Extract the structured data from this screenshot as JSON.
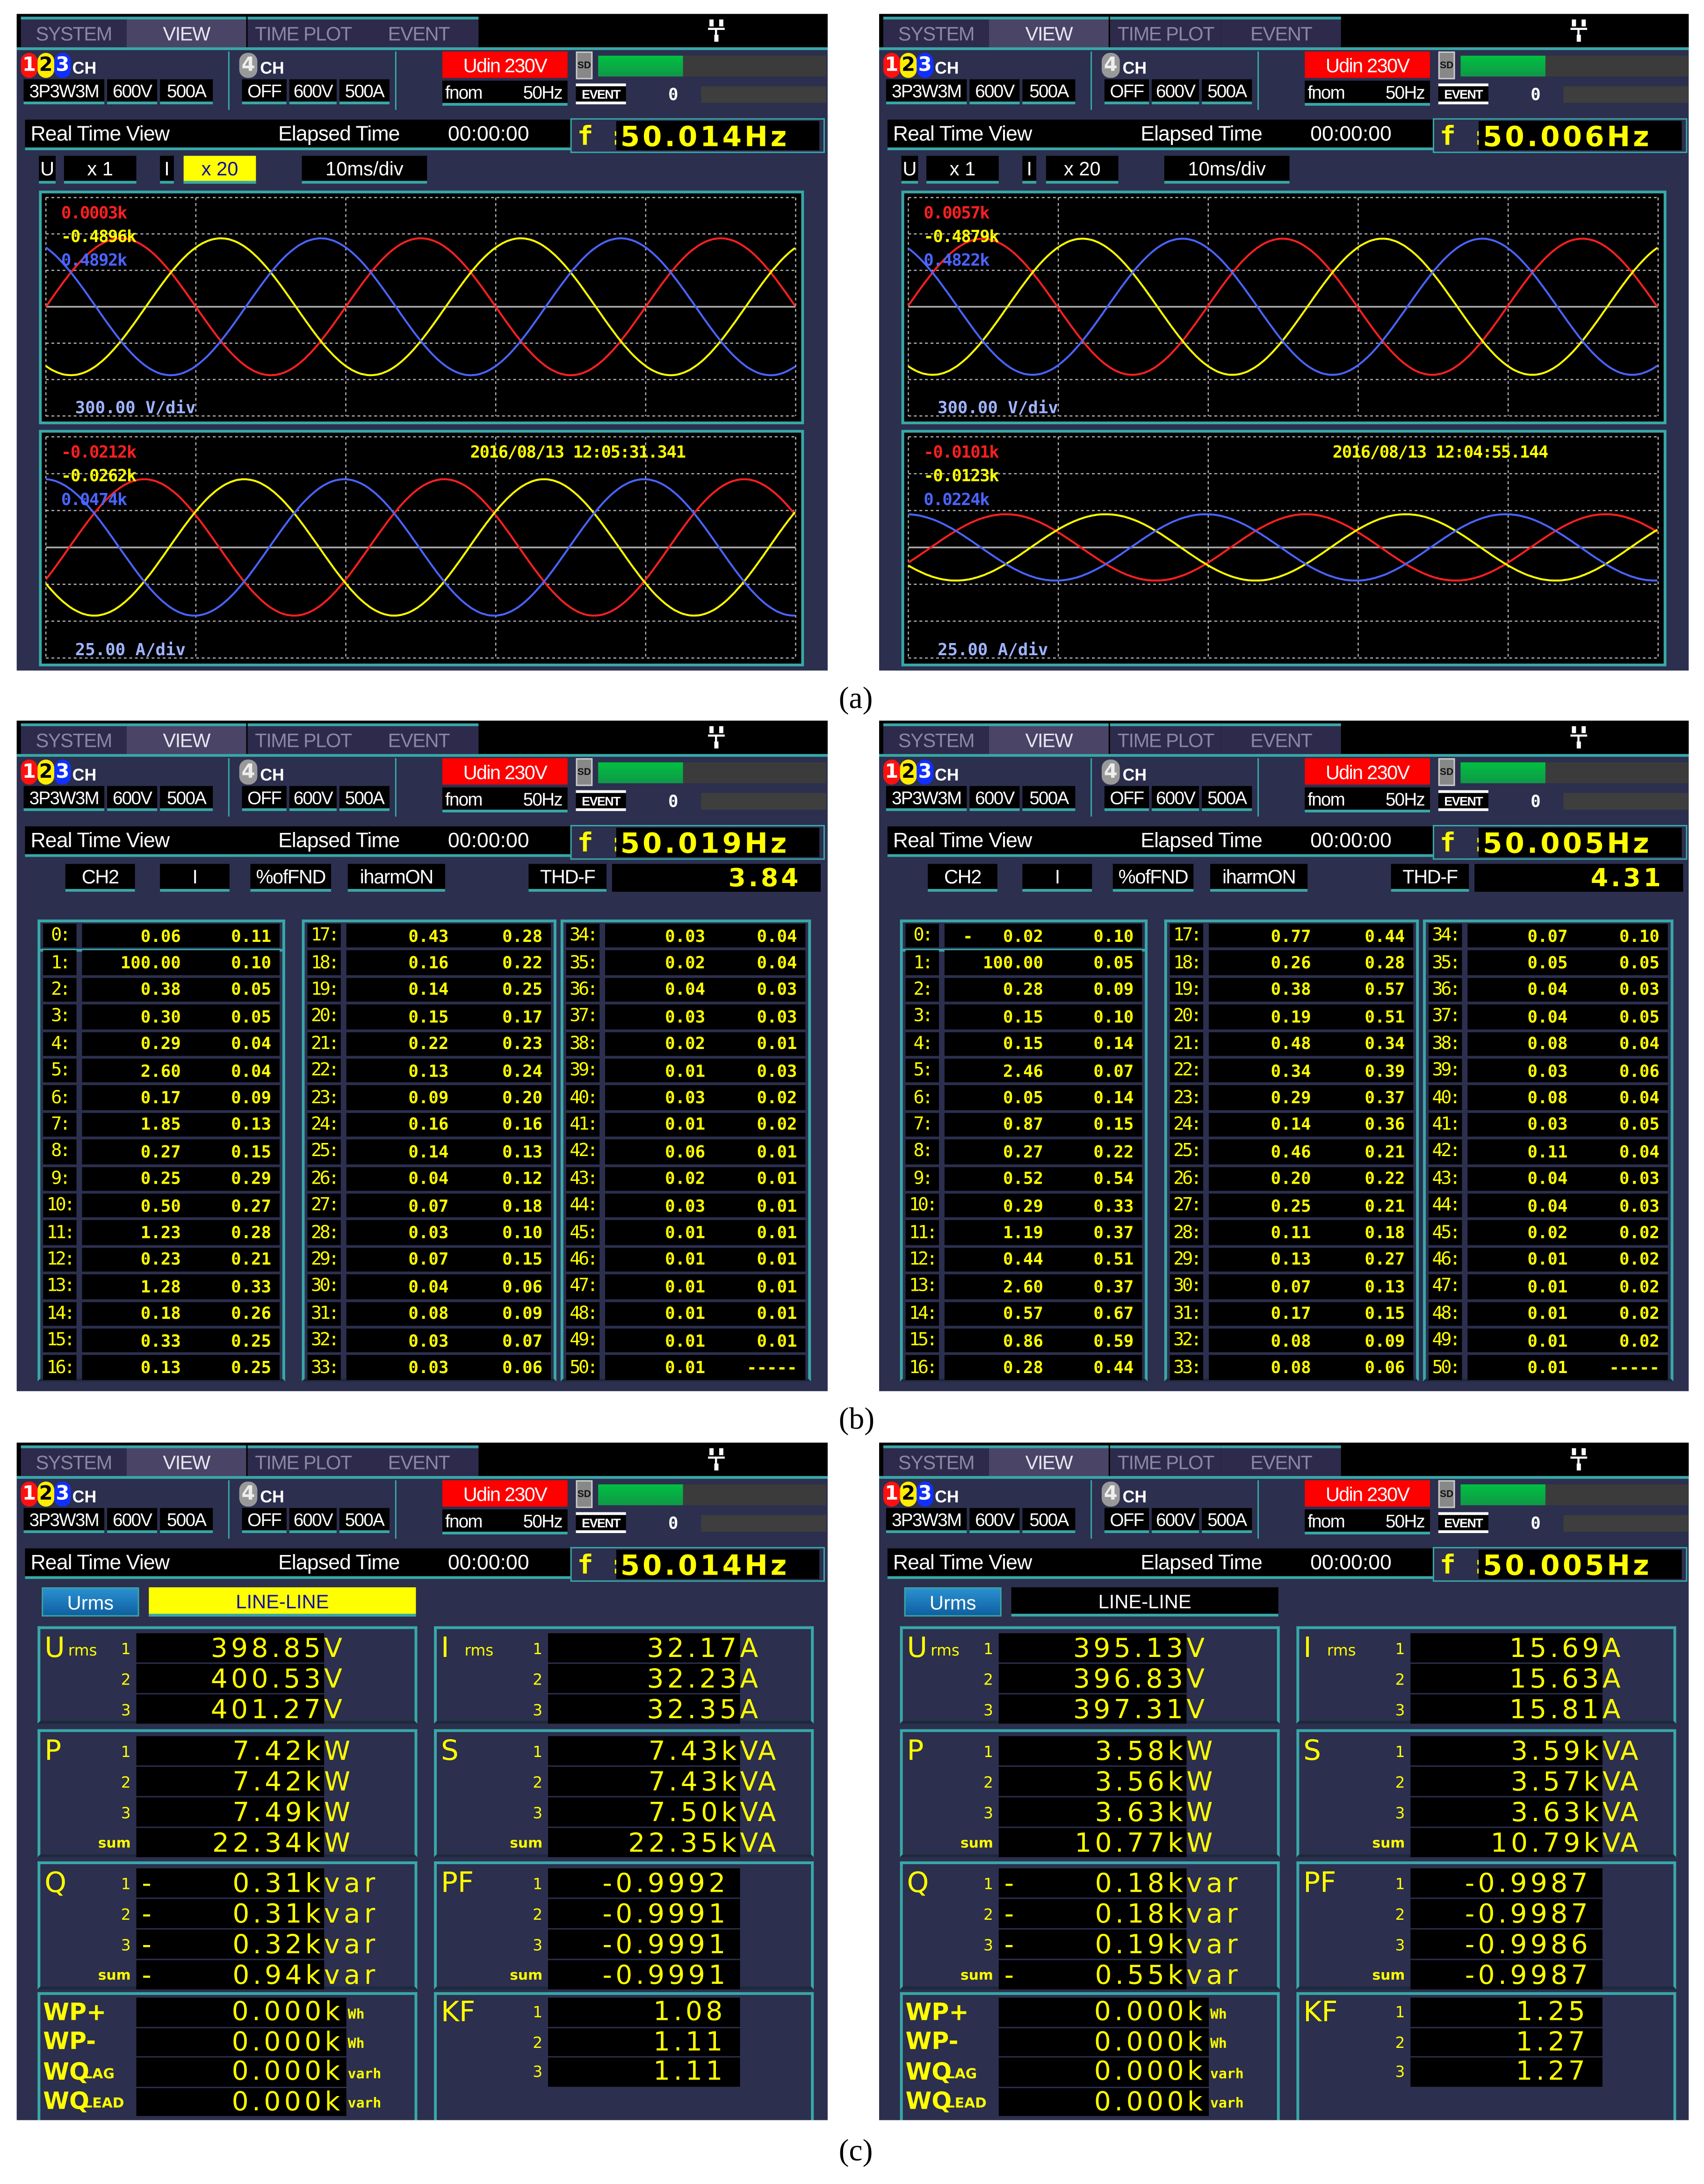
{
  "header": {
    "tabs": [
      "SYSTEM",
      "VIEW",
      "TIME PLOT",
      "EVENT"
    ],
    "active_tab": "VIEW",
    "ch123": {
      "num": [
        "1",
        "2",
        "3"
      ],
      "suffix": "CH",
      "wiring": "3P3W3M",
      "range_v": "600V",
      "range_a": "500A"
    },
    "ch4": {
      "num": "4",
      "suffix": "CH",
      "state": "OFF",
      "range_v": "600V",
      "range_a": "500A"
    },
    "udin": "Udin 230V",
    "fnom_label": "fnom",
    "fnom": "50Hz",
    "sd": "SD",
    "sd_usage_percent": 37,
    "event_label": "EVENT",
    "event_count": "0",
    "mode": "Real Time View",
    "elapsed_label": "Elapsed Time",
    "elapsed": "00:00:00",
    "freq_label": "f :"
  },
  "figure_labels": {
    "a": "(a)",
    "b": "(b)",
    "c": "(c)"
  },
  "colors": {
    "phase1": "#ff2020",
    "phase2": "#ffff00",
    "phase3": "#4a64ff",
    "accent": "#38a8a8",
    "screen_bg": "#2c2f4e"
  },
  "screens": [
    {
      "panel": "a",
      "freq": "50.014Hz",
      "controls": {
        "u_label": "U",
        "u_scale": "x 1",
        "i_label": "I",
        "i_scale": "x 20",
        "i_scale_highlighted": true,
        "timebase": "10ms/div"
      },
      "cycles": 2.5,
      "voltage": {
        "readouts": [
          "0.0003k",
          "-0.4896k",
          "0.4892k"
        ],
        "scale": "300.00 V/div",
        "amplitude_div": 1.88,
        "phase_deg": [
          0,
          -120,
          120
        ]
      },
      "current": {
        "readouts": [
          "-0.0212k",
          "-0.0262k",
          "0.0474k"
        ],
        "timestamp": "2016/08/13 12:05:31.341",
        "scale": "25.00 A/div",
        "amplitude_div": 1.85,
        "phase_deg": [
          -28,
          -148,
          92
        ]
      }
    },
    {
      "panel": "a",
      "freq": "50.006Hz",
      "controls": {
        "u_label": "U",
        "u_scale": "x 1",
        "i_label": "I",
        "i_scale": "x 20",
        "i_scale_highlighted": false,
        "timebase": "10ms/div"
      },
      "cycles": 2.5,
      "voltage": {
        "readouts": [
          "0.0057k",
          "-0.4879k",
          "0.4822k"
        ],
        "scale": "300.00 V/div",
        "amplitude_div": 1.87,
        "phase_deg": [
          1,
          -119,
          121
        ]
      },
      "current": {
        "readouts": [
          "-0.0101k",
          "-0.0123k",
          "0.0224k"
        ],
        "timestamp": "2016/08/13 12:04:55.144",
        "scale": "25.00 A/div",
        "amplitude_div": 0.9,
        "phase_deg": [
          -27,
          -147,
          93
        ]
      }
    },
    {
      "panel": "b",
      "freq": "50.019Hz",
      "controls": {
        "channel": "CH2",
        "quantity": "I",
        "unit": "%ofFND",
        "mode": "iharmON",
        "thd_label": "THD-F",
        "thd_value": "3.84"
      },
      "harmonics": [
        [
          [
            "0:",
            "0.06",
            "0.11"
          ],
          [
            "1:",
            "100.00",
            "0.10"
          ],
          [
            "2:",
            "0.38",
            "0.05"
          ],
          [
            "3:",
            "0.30",
            "0.05"
          ],
          [
            "4:",
            "0.29",
            "0.04"
          ],
          [
            "5:",
            "2.60",
            "0.04"
          ],
          [
            "6:",
            "0.17",
            "0.09"
          ],
          [
            "7:",
            "1.85",
            "0.13"
          ],
          [
            "8:",
            "0.27",
            "0.15"
          ],
          [
            "9:",
            "0.25",
            "0.29"
          ],
          [
            "10:",
            "0.50",
            "0.27"
          ],
          [
            "11:",
            "1.23",
            "0.28"
          ],
          [
            "12:",
            "0.23",
            "0.21"
          ],
          [
            "13:",
            "1.28",
            "0.33"
          ],
          [
            "14:",
            "0.18",
            "0.26"
          ],
          [
            "15:",
            "0.33",
            "0.25"
          ],
          [
            "16:",
            "0.13",
            "0.25"
          ]
        ],
        [
          [
            "17:",
            "0.43",
            "0.28"
          ],
          [
            "18:",
            "0.16",
            "0.22"
          ],
          [
            "19:",
            "0.14",
            "0.25"
          ],
          [
            "20:",
            "0.15",
            "0.17"
          ],
          [
            "21:",
            "0.22",
            "0.23"
          ],
          [
            "22:",
            "0.13",
            "0.24"
          ],
          [
            "23:",
            "0.09",
            "0.20"
          ],
          [
            "24:",
            "0.16",
            "0.16"
          ],
          [
            "25:",
            "0.14",
            "0.13"
          ],
          [
            "26:",
            "0.04",
            "0.12"
          ],
          [
            "27:",
            "0.07",
            "0.18"
          ],
          [
            "28:",
            "0.03",
            "0.10"
          ],
          [
            "29:",
            "0.07",
            "0.15"
          ],
          [
            "30:",
            "0.04",
            "0.06"
          ],
          [
            "31:",
            "0.08",
            "0.09"
          ],
          [
            "32:",
            "0.03",
            "0.07"
          ],
          [
            "33:",
            "0.03",
            "0.06"
          ]
        ],
        [
          [
            "34:",
            "0.03",
            "0.04"
          ],
          [
            "35:",
            "0.02",
            "0.04"
          ],
          [
            "36:",
            "0.04",
            "0.03"
          ],
          [
            "37:",
            "0.03",
            "0.03"
          ],
          [
            "38:",
            "0.02",
            "0.01"
          ],
          [
            "39:",
            "0.01",
            "0.03"
          ],
          [
            "40:",
            "0.03",
            "0.02"
          ],
          [
            "41:",
            "0.01",
            "0.02"
          ],
          [
            "42:",
            "0.06",
            "0.01"
          ],
          [
            "43:",
            "0.02",
            "0.01"
          ],
          [
            "44:",
            "0.03",
            "0.01"
          ],
          [
            "45:",
            "0.01",
            "0.01"
          ],
          [
            "46:",
            "0.01",
            "0.01"
          ],
          [
            "47:",
            "0.01",
            "0.01"
          ],
          [
            "48:",
            "0.01",
            "0.01"
          ],
          [
            "49:",
            "0.01",
            "0.01"
          ],
          [
            "50:",
            "0.01",
            "-----"
          ]
        ]
      ]
    },
    {
      "panel": "b",
      "freq": "50.005Hz",
      "controls": {
        "channel": "CH2",
        "quantity": "I",
        "unit": "%ofFND",
        "mode": "iharmON",
        "thd_label": "THD-F",
        "thd_value": "4.31"
      },
      "harmonics": [
        [
          [
            "0:",
            "-   0.02",
            "0.10"
          ],
          [
            "1:",
            "100.00",
            "0.05"
          ],
          [
            "2:",
            "0.28",
            "0.09"
          ],
          [
            "3:",
            "0.15",
            "0.10"
          ],
          [
            "4:",
            "0.15",
            "0.14"
          ],
          [
            "5:",
            "2.46",
            "0.07"
          ],
          [
            "6:",
            "0.05",
            "0.14"
          ],
          [
            "7:",
            "0.87",
            "0.15"
          ],
          [
            "8:",
            "0.27",
            "0.22"
          ],
          [
            "9:",
            "0.52",
            "0.54"
          ],
          [
            "10:",
            "0.29",
            "0.33"
          ],
          [
            "11:",
            "1.19",
            "0.37"
          ],
          [
            "12:",
            "0.44",
            "0.51"
          ],
          [
            "13:",
            "2.60",
            "0.37"
          ],
          [
            "14:",
            "0.57",
            "0.67"
          ],
          [
            "15:",
            "0.86",
            "0.59"
          ],
          [
            "16:",
            "0.28",
            "0.44"
          ]
        ],
        [
          [
            "17:",
            "0.77",
            "0.44"
          ],
          [
            "18:",
            "0.26",
            "0.28"
          ],
          [
            "19:",
            "0.38",
            "0.57"
          ],
          [
            "20:",
            "0.19",
            "0.51"
          ],
          [
            "21:",
            "0.48",
            "0.34"
          ],
          [
            "22:",
            "0.34",
            "0.39"
          ],
          [
            "23:",
            "0.29",
            "0.37"
          ],
          [
            "24:",
            "0.14",
            "0.36"
          ],
          [
            "25:",
            "0.46",
            "0.21"
          ],
          [
            "26:",
            "0.20",
            "0.22"
          ],
          [
            "27:",
            "0.25",
            "0.21"
          ],
          [
            "28:",
            "0.11",
            "0.18"
          ],
          [
            "29:",
            "0.13",
            "0.27"
          ],
          [
            "30:",
            "0.07",
            "0.13"
          ],
          [
            "31:",
            "0.17",
            "0.15"
          ],
          [
            "32:",
            "0.08",
            "0.09"
          ],
          [
            "33:",
            "0.08",
            "0.06"
          ]
        ],
        [
          [
            "34:",
            "0.07",
            "0.10"
          ],
          [
            "35:",
            "0.05",
            "0.05"
          ],
          [
            "36:",
            "0.04",
            "0.03"
          ],
          [
            "37:",
            "0.04",
            "0.05"
          ],
          [
            "38:",
            "0.08",
            "0.04"
          ],
          [
            "39:",
            "0.03",
            "0.06"
          ],
          [
            "40:",
            "0.08",
            "0.04"
          ],
          [
            "41:",
            "0.03",
            "0.05"
          ],
          [
            "42:",
            "0.11",
            "0.04"
          ],
          [
            "43:",
            "0.04",
            "0.03"
          ],
          [
            "44:",
            "0.04",
            "0.03"
          ],
          [
            "45:",
            "0.02",
            "0.02"
          ],
          [
            "46:",
            "0.01",
            "0.02"
          ],
          [
            "47:",
            "0.01",
            "0.02"
          ],
          [
            "48:",
            "0.01",
            "0.02"
          ],
          [
            "49:",
            "0.01",
            "0.02"
          ],
          [
            "50:",
            "0.01",
            "-----"
          ]
        ]
      ]
    },
    {
      "panel": "c",
      "freq": "50.014Hz",
      "controls": {
        "button": "Urms",
        "connection": "LINE-LINE",
        "connection_highlighted": true
      },
      "urms": {
        "label": "U",
        "sub": "rms",
        "phases": [
          "1",
          "2",
          "3"
        ],
        "values": [
          "398.85",
          "400.53",
          "401.27"
        ],
        "unit": "V"
      },
      "irms": {
        "label": "I",
        "sub": "rms",
        "phases": [
          "1",
          "2",
          "3"
        ],
        "values": [
          "32.17",
          "32.23",
          "32.35"
        ],
        "unit": "A"
      },
      "p": {
        "label": "P",
        "phases": [
          "1",
          "2",
          "3",
          "sum"
        ],
        "values": [
          "7.42k",
          "7.42k",
          "7.49k",
          "22.34k"
        ],
        "unit": "W"
      },
      "s": {
        "label": "S",
        "phases": [
          "1",
          "2",
          "3",
          "sum"
        ],
        "values": [
          "7.43k",
          "7.43k",
          "7.50k",
          "22.35k"
        ],
        "unit": "VA"
      },
      "q": {
        "label": "Q",
        "phases": [
          "1",
          "2",
          "3",
          "sum"
        ],
        "sign": "-",
        "values": [
          "0.31k",
          "0.31k",
          "0.32k",
          "0.94k"
        ],
        "unit": "var"
      },
      "pf": {
        "label": "PF",
        "phases": [
          "1",
          "2",
          "3",
          "sum"
        ],
        "values": [
          "-0.9992",
          "-0.9991",
          "-0.9991",
          "-0.9991"
        ]
      },
      "energy": [
        {
          "label": "WP+",
          "sub": "",
          "value": "0.000k",
          "unit": "Wh"
        },
        {
          "label": "WP-",
          "sub": "",
          "value": "0.000k",
          "unit": "Wh"
        },
        {
          "label": "WQ",
          "sub": "LAG",
          "value": "0.000k",
          "unit": "varh"
        },
        {
          "label": "WQ",
          "sub": "LEAD",
          "value": "0.000k",
          "unit": "varh"
        }
      ],
      "kf": {
        "label": "KF",
        "phases": [
          "1",
          "2",
          "3"
        ],
        "values": [
          "1.08",
          "1.11",
          "1.11"
        ]
      }
    },
    {
      "panel": "c",
      "freq": "50.005Hz",
      "controls": {
        "button": "Urms",
        "connection": "LINE-LINE",
        "connection_highlighted": false
      },
      "urms": {
        "label": "U",
        "sub": "rms",
        "phases": [
          "1",
          "2",
          "3"
        ],
        "values": [
          "395.13",
          "396.83",
          "397.31"
        ],
        "unit": "V"
      },
      "irms": {
        "label": "I",
        "sub": "rms",
        "phases": [
          "1",
          "2",
          "3"
        ],
        "values": [
          "15.69",
          "15.63",
          "15.81"
        ],
        "unit": "A"
      },
      "p": {
        "label": "P",
        "phases": [
          "1",
          "2",
          "3",
          "sum"
        ],
        "values": [
          "3.58k",
          "3.56k",
          "3.63k",
          "10.77k"
        ],
        "unit": "W"
      },
      "s": {
        "label": "S",
        "phases": [
          "1",
          "2",
          "3",
          "sum"
        ],
        "values": [
          "3.59k",
          "3.57k",
          "3.63k",
          "10.79k"
        ],
        "unit": "VA"
      },
      "q": {
        "label": "Q",
        "phases": [
          "1",
          "2",
          "3",
          "sum"
        ],
        "sign": "-",
        "values": [
          "0.18k",
          "0.18k",
          "0.19k",
          "0.55k"
        ],
        "unit": "var"
      },
      "pf": {
        "label": "PF",
        "phases": [
          "1",
          "2",
          "3",
          "sum"
        ],
        "values": [
          "-0.9987",
          "-0.9987",
          "-0.9986",
          "-0.9987"
        ]
      },
      "energy": [
        {
          "label": "WP+",
          "sub": "",
          "value": "0.000k",
          "unit": "Wh"
        },
        {
          "label": "WP-",
          "sub": "",
          "value": "0.000k",
          "unit": "Wh"
        },
        {
          "label": "WQ",
          "sub": "LAG",
          "value": "0.000k",
          "unit": "varh"
        },
        {
          "label": "WQ",
          "sub": "LEAD",
          "value": "0.000k",
          "unit": "varh"
        }
      ],
      "kf": {
        "label": "KF",
        "phases": [
          "1",
          "2",
          "3"
        ],
        "values": [
          "1.25",
          "1.27",
          "1.27"
        ]
      }
    }
  ]
}
